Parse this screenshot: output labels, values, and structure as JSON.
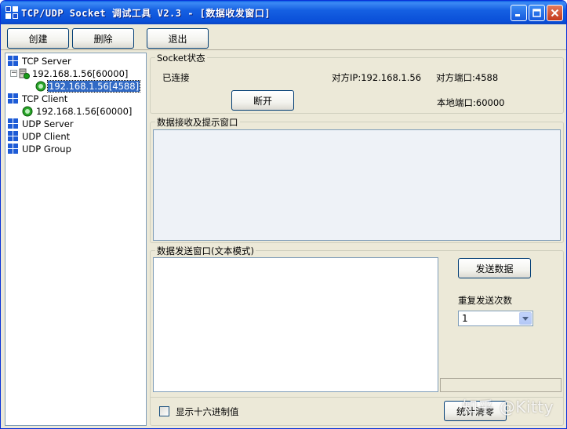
{
  "window": {
    "title": "TCP/UDP Socket 调试工具 V2.3 - [数据收发窗口]"
  },
  "toolbar": {
    "create_label": "创建",
    "delete_label": "删除",
    "exit_label": "退出"
  },
  "tree": {
    "tcp_server": "TCP Server",
    "tcp_server_listener": "192.168.1.56[60000]",
    "tcp_server_conn": "192.168.1.56[4588]",
    "tcp_client": "TCP Client",
    "tcp_client_conn": "192.168.1.56[60000]",
    "udp_server": "UDP Server",
    "udp_client": "UDP Client",
    "udp_group": "UDP Group"
  },
  "socket_status": {
    "legend": "Socket状态",
    "state": "已连接",
    "peer_ip": "对方IP:192.168.1.56",
    "peer_port": "对方端口:4588",
    "local_port": "本地端口:60000",
    "disconnect_label": "断开"
  },
  "receive": {
    "legend": "数据接收及提示窗口"
  },
  "send": {
    "legend": "数据发送窗口(文本模式)",
    "send_label": "发送数据",
    "repeat_label": "重复发送次数",
    "repeat_value": "1",
    "hex_label": "显示十六进制值",
    "stats_reset_label": "统计清零"
  },
  "watermark": "知乎 @Kitty",
  "colors": {
    "title_bar": "#0a4fd8",
    "selection": "#316ac5",
    "face": "#ece9d8"
  }
}
